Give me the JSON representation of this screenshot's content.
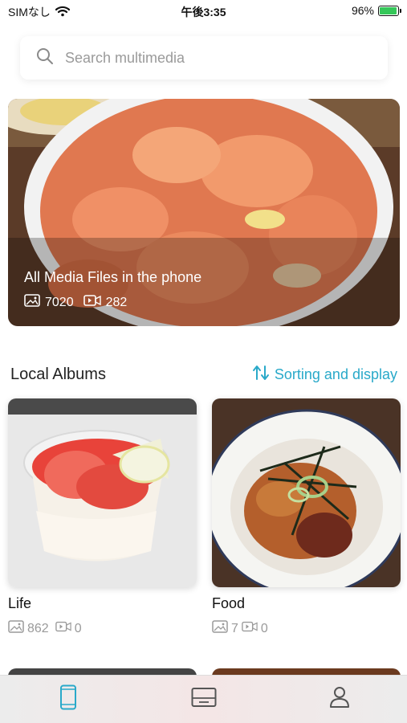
{
  "status_bar": {
    "carrier": "SIMなし",
    "time": "午後3:35",
    "battery_percent": "96%",
    "battery_level": 0.96
  },
  "search": {
    "placeholder": "Search multimedia"
  },
  "hero": {
    "title": "All Media Files in the phone",
    "photo_count": "7020",
    "video_count": "282"
  },
  "section": {
    "title": "Local Albums",
    "sort_label": "Sorting and display"
  },
  "albums": [
    {
      "name": "Life",
      "photo_count": "862",
      "video_count": "0"
    },
    {
      "name": "Food",
      "photo_count": "7",
      "video_count": "0"
    }
  ],
  "tabs": [
    {
      "icon": "phone-icon",
      "active": true
    },
    {
      "icon": "album-icon",
      "active": false
    },
    {
      "icon": "person-icon",
      "active": false
    }
  ],
  "colors": {
    "accent": "#29a9c9",
    "muted": "#9a9a9a",
    "tab_inactive": "#555555"
  }
}
